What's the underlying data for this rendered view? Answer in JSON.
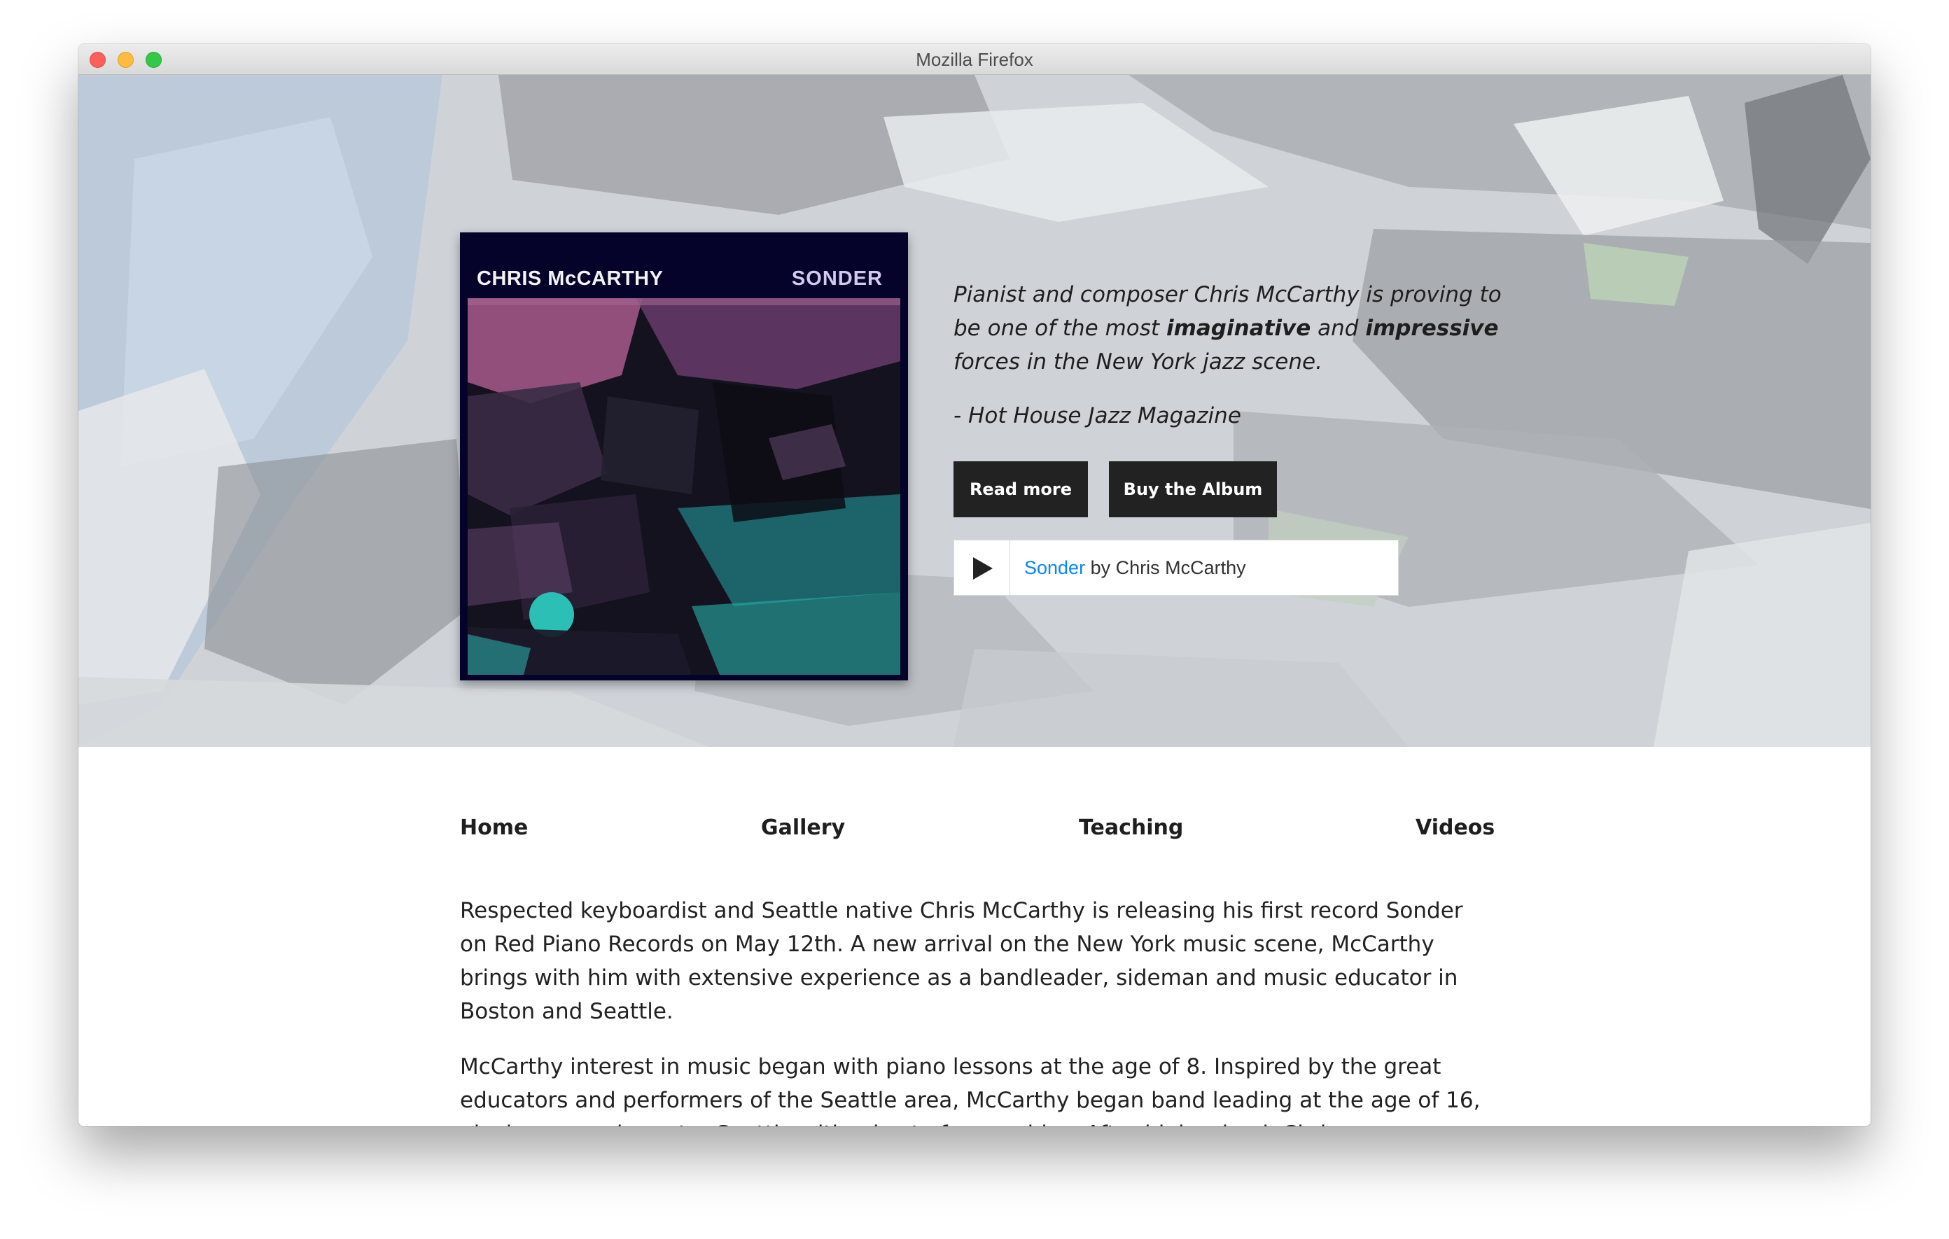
{
  "window": {
    "title": "Mozilla Firefox"
  },
  "album": {
    "artist": "CHRIS McCARTHY",
    "title": "SONDER"
  },
  "quote": {
    "part1": "Pianist and composer Chris McCarthy is proving to be one of the most ",
    "bold1": "imaginative",
    "part2": " and ",
    "bold2": "impressive",
    "part3": " forces in the New York jazz scene.",
    "source": "- Hot House Jazz Magazine"
  },
  "buttons": {
    "read_more": "Read more",
    "buy_album": "Buy the Album"
  },
  "player": {
    "track": "Sonder",
    "by": " by Chris McCarthy"
  },
  "nav": {
    "home": "Home",
    "gallery": "Gallery",
    "teaching": "Teaching",
    "videos": "Videos"
  },
  "content": {
    "para1": "Respected keyboardist and Seattle native Chris McCarthy is releasing his first record Sonder on Red Piano Records on May 12th. A new arrival on the New York music scene, McCarthy brings with him with extensive experience as a bandleader, sideman and music educator in Boston and Seattle.",
    "para2": "McCarthy interest in music began with piano lessons at the age of 8. Inspired by the great educators and performers of the Seattle area, McCarthy began band leading at the age of 16, playing around greater Seattle with a host of ensembles. After high school, Chris"
  },
  "colors": {
    "nav_text": "#1e1e1e",
    "button_bg": "#222222",
    "link": "#0687f5",
    "album_bg": "#05032a"
  }
}
